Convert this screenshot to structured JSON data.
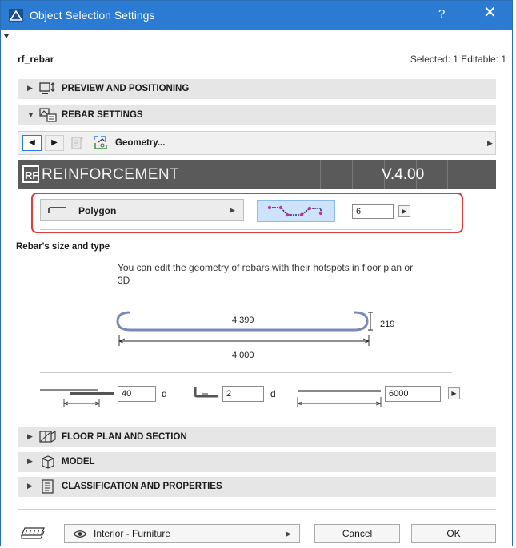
{
  "window": {
    "title": "Object Selection Settings",
    "help": "?",
    "close": "✕"
  },
  "header": {
    "object_name": "rf_rebar",
    "selection_info": "Selected: 1 Editable: 1"
  },
  "sections": {
    "preview": "PREVIEW AND POSITIONING",
    "rebar": "REBAR SETTINGS",
    "floor": "FLOOR PLAN AND SECTION",
    "model": "MODEL",
    "classification": "CLASSIFICATION AND PROPERTIES"
  },
  "toolbar": {
    "page_label": "Geometry..."
  },
  "banner": {
    "logo": "RF",
    "name": "REINFORCEMENT",
    "version": "V.4.00"
  },
  "shape": {
    "label": "Polygon",
    "count": "6"
  },
  "rebar_size": {
    "heading": "Rebar's size and type",
    "hint": "You can edit the geometry of rebars with their hotspots in floor plan or 3D",
    "length_label": "4 399",
    "height_label": "219",
    "total_label": "4 000"
  },
  "params": {
    "anchor_value": "40",
    "anchor_unit": "d",
    "hook_value": "2",
    "hook_unit": "d",
    "bar_length": "6000"
  },
  "footer": {
    "layer": "Interior - Furniture",
    "cancel": "Cancel",
    "ok": "OK"
  },
  "colors": {
    "title_bar": "#2b7bd3",
    "highlight_border": "#e03a3a",
    "rebar_stroke": "#7b87b8"
  }
}
